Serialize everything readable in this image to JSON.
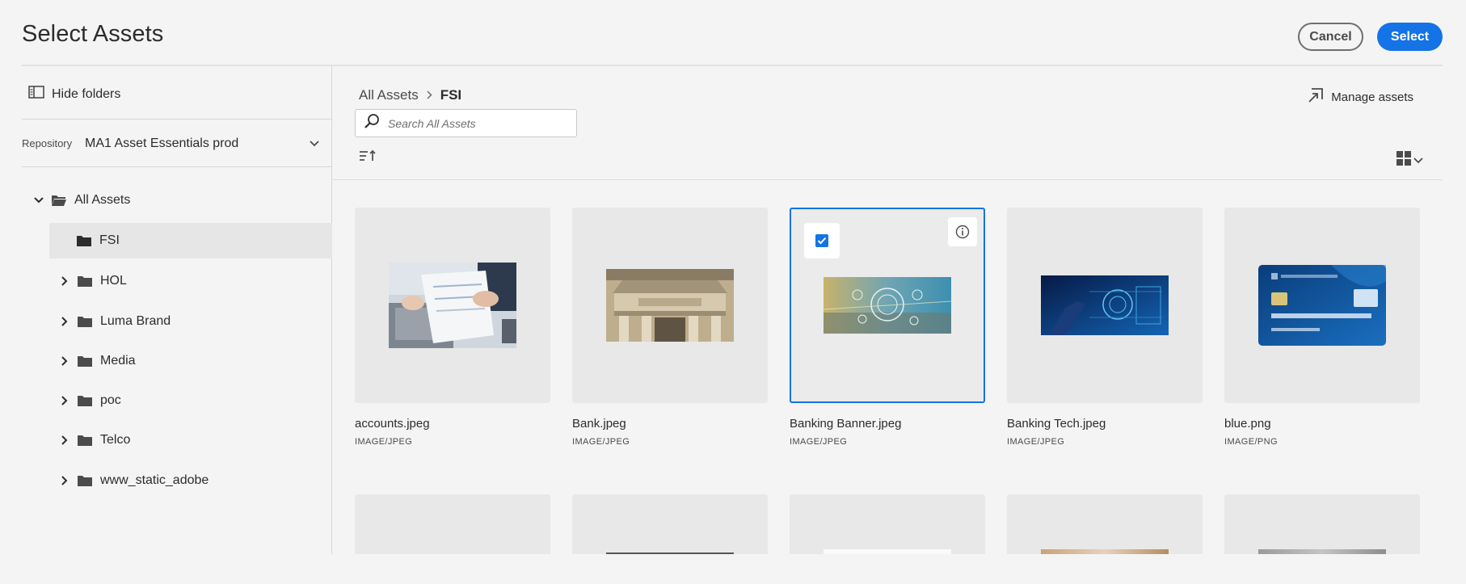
{
  "header": {
    "title": "Select Assets",
    "cancel_label": "Cancel",
    "select_label": "Select"
  },
  "sidebar": {
    "hide_folders_label": "Hide folders",
    "repository_label": "Repository",
    "repository_value": "MA1 Asset Essentials prod",
    "root_label": "All Assets",
    "folders": [
      {
        "label": "FSI",
        "selected": true,
        "expandable": false
      },
      {
        "label": "HOL",
        "selected": false,
        "expandable": true
      },
      {
        "label": "Luma Brand",
        "selected": false,
        "expandable": true
      },
      {
        "label": "Media",
        "selected": false,
        "expandable": true
      },
      {
        "label": "poc",
        "selected": false,
        "expandable": true
      },
      {
        "label": "Telco",
        "selected": false,
        "expandable": true
      },
      {
        "label": "www_static_adobe",
        "selected": false,
        "expandable": true
      }
    ]
  },
  "main": {
    "breadcrumb_root": "All Assets",
    "breadcrumb_current": "FSI",
    "manage_assets_label": "Manage assets",
    "search_placeholder": "Search All Assets",
    "assets": [
      {
        "name": "accounts.jpeg",
        "type": "IMAGE/JPEG",
        "selected": false
      },
      {
        "name": "Bank.jpeg",
        "type": "IMAGE/JPEG",
        "selected": false
      },
      {
        "name": "Banking Banner.jpeg",
        "type": "IMAGE/JPEG",
        "selected": true
      },
      {
        "name": "Banking Tech.jpeg",
        "type": "IMAGE/JPEG",
        "selected": false
      },
      {
        "name": "blue.png",
        "type": "IMAGE/PNG",
        "selected": false
      }
    ]
  },
  "colors": {
    "accent": "#1473e6",
    "background": "#f4f4f4"
  }
}
